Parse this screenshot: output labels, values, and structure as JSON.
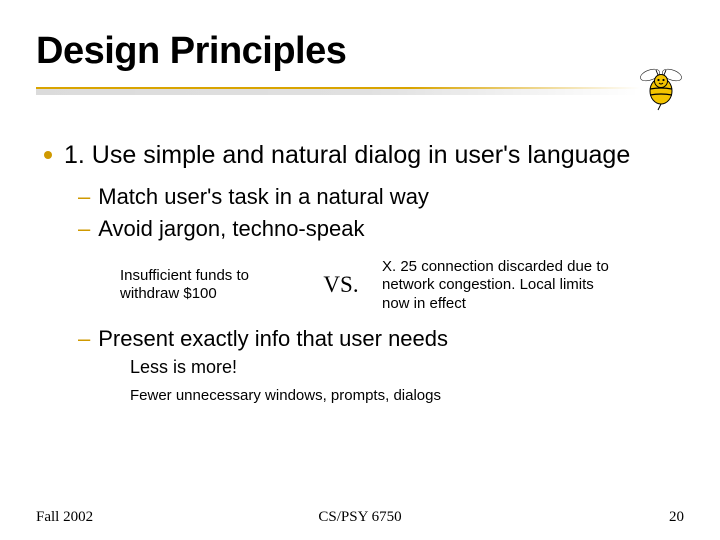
{
  "title": "Design Principles",
  "bullet1": "1. Use simple and natural dialog in user's language",
  "sub1": "Match user's task in a natural way",
  "sub2": "Avoid jargon, techno-speak",
  "compare": {
    "left": "Insufficient funds to withdraw $100",
    "vs": "VS.",
    "right": "X. 25 connection discarded due to network congestion.  Local limits now in effect"
  },
  "sub3": "Present exactly info that user needs",
  "subsub1": "Less is more!",
  "subsub2": "Fewer unnecessary windows, prompts, dialogs",
  "footer": {
    "left": "Fall 2002",
    "center": "CS/PSY 6750",
    "right": "20"
  }
}
